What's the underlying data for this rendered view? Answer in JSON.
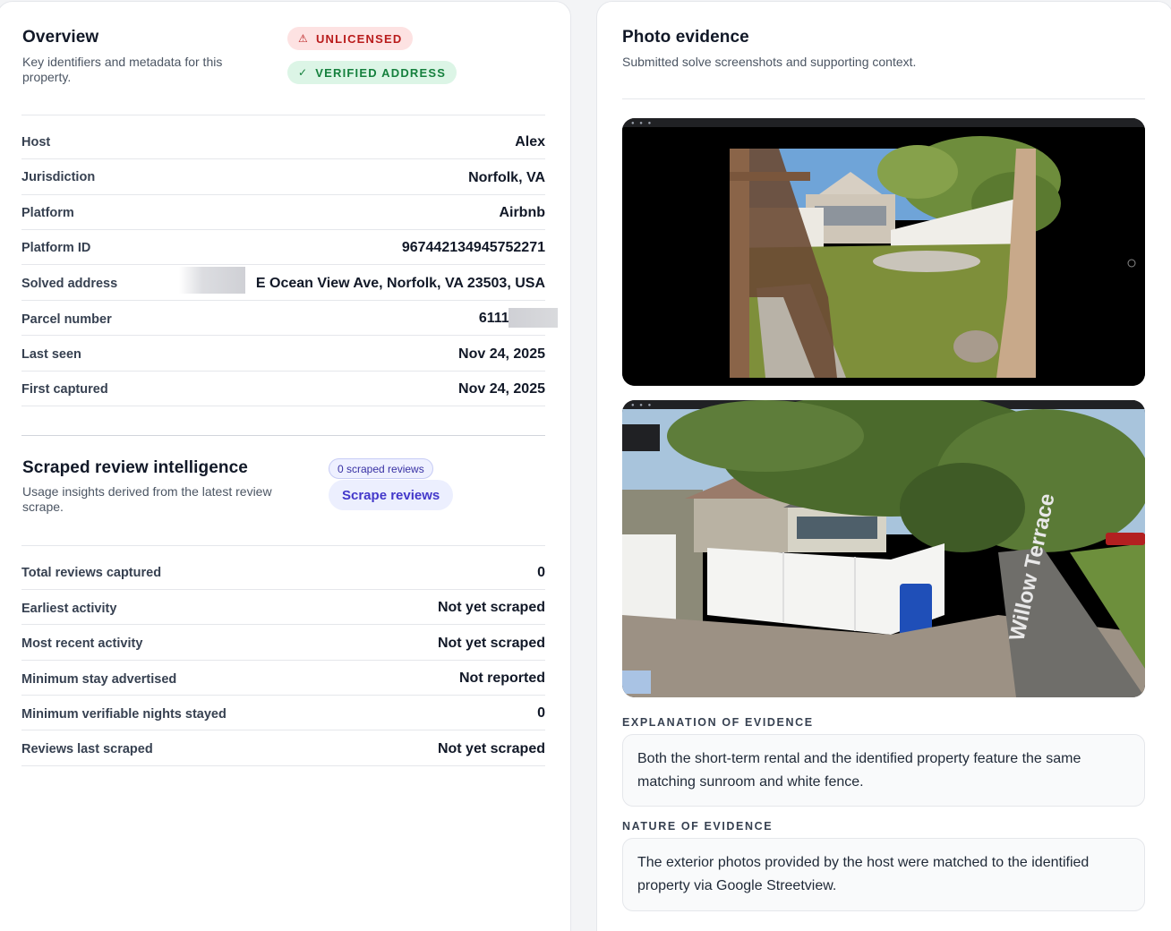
{
  "overview": {
    "title": "Overview",
    "subtitle": "Key identifiers and metadata for this property.",
    "badges": {
      "unlicensed": "UNLICENSED",
      "verified": "VERIFIED ADDRESS"
    },
    "rows": [
      {
        "label": "Host",
        "value": "Alex"
      },
      {
        "label": "Jurisdiction",
        "value": "Norfolk, VA"
      },
      {
        "label": "Platform",
        "value": "Airbnb"
      },
      {
        "label": "Platform ID",
        "value": "967442134945752271"
      },
      {
        "label": "Solved address",
        "value": "E Ocean View Ave, Norfolk, VA 23503, USA"
      },
      {
        "label": "Parcel number",
        "value": "6111("
      },
      {
        "label": "Last seen",
        "value": "Nov 24, 2025"
      },
      {
        "label": "First captured",
        "value": "Nov 24, 2025"
      }
    ]
  },
  "reviews": {
    "title": "Scraped review intelligence",
    "subtitle": "Usage insights derived from the latest review scrape.",
    "count_badge": "0 scraped reviews",
    "scrape_button": "Scrape reviews",
    "rows": [
      {
        "label": "Total reviews captured",
        "value": "0"
      },
      {
        "label": "Earliest activity",
        "value": "Not yet scraped"
      },
      {
        "label": "Most recent activity",
        "value": "Not yet scraped"
      },
      {
        "label": "Minimum stay advertised",
        "value": "Not reported"
      },
      {
        "label": "Minimum verifiable nights stayed",
        "value": "0"
      },
      {
        "label": "Reviews last scraped",
        "value": "Not yet scraped"
      }
    ]
  },
  "evidence": {
    "title": "Photo evidence",
    "subtitle": "Submitted solve screenshots and supporting context.",
    "photo_street_sign": "Willow Terrace",
    "explanation_label": "EXPLANATION OF EVIDENCE",
    "explanation_text": "Both the short-term rental and the identified property feature the same matching sunroom and white fence.",
    "nature_label": "NATURE OF EVIDENCE",
    "nature_text": "The exterior photos provided by the host were matched to the identified property via Google Streetview."
  },
  "colors": {
    "danger": "#b91c1c",
    "success": "#15803d",
    "accent": "#4338ca"
  },
  "icons": {
    "unlicensed": "warning-triangle-icon",
    "verified": "check-icon"
  }
}
